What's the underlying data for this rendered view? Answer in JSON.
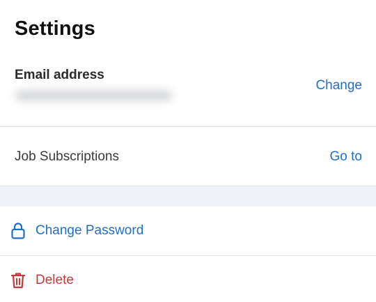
{
  "page": {
    "title": "Settings"
  },
  "email": {
    "label": "Email address",
    "change_label": "Change"
  },
  "jobs": {
    "label": "Job Subscriptions",
    "goto_label": "Go to"
  },
  "actions": {
    "change_password": {
      "label": "Change Password",
      "icon": "lock-icon"
    },
    "delete": {
      "label": "Delete",
      "icon": "trash-icon"
    }
  },
  "colors": {
    "link_blue": "#1f6fc8",
    "danger_red": "#c23b36",
    "divider": "#e3e5e8",
    "band_bg": "#eef1f5"
  }
}
